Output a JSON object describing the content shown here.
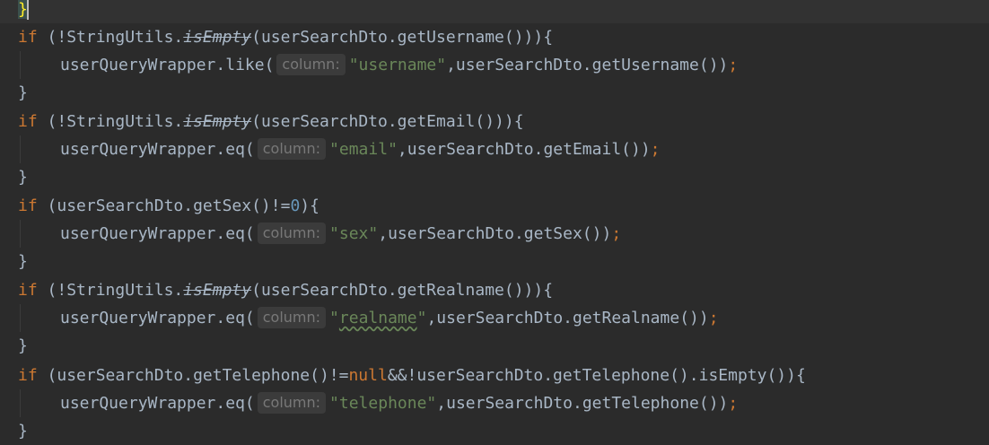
{
  "editor": {
    "lines": [
      {
        "brace": "}"
      },
      {
        "kw": "if",
        "open": " (!StringUtils.",
        "call": "isEmpty",
        "rest": "(userSearchDto.getUsername())){"
      },
      {
        "pre": "userQueryWrapper.like(",
        "hint": "column:",
        "str": "\"username\"",
        "post": ",userSearchDto.getUsername())",
        "semi": ";"
      },
      {
        "brace": "}"
      },
      {
        "kw": "if",
        "open": " (!StringUtils.",
        "call": "isEmpty",
        "rest": "(userSearchDto.getEmail())){"
      },
      {
        "pre": "userQueryWrapper.eq(",
        "hint": "column:",
        "str": "\"email\"",
        "post": ",userSearchDto.getEmail())",
        "semi": ";"
      },
      {
        "brace": "}"
      },
      {
        "kw": "if",
        "open": " (userSearchDto.getSex()!=",
        "num": "0",
        "rest": "){"
      },
      {
        "pre": "userQueryWrapper.eq(",
        "hint": "column:",
        "str": "\"sex\"",
        "post": ",userSearchDto.getSex())",
        "semi": ";"
      },
      {
        "brace": "}"
      },
      {
        "kw": "if",
        "open": " (!StringUtils.",
        "call": "isEmpty",
        "rest": "(userSearchDto.getRealname())){"
      },
      {
        "pre": "userQueryWrapper.eq(",
        "hint": "column:",
        "str_q1": "\"",
        "str_word": "realname",
        "str_q2": "\"",
        "post": ",userSearchDto.getRealname())",
        "semi": ";"
      },
      {
        "brace": "}"
      },
      {
        "kw": "if",
        "open": " (userSearchDto.getTelephone()!=",
        "kw2": "null",
        "rest": "&&!userSearchDto.getTelephone().isEmpty()){"
      },
      {
        "pre": "userQueryWrapper.eq(",
        "hint": "column:",
        "str": "\"telephone\"",
        "post": ",userSearchDto.getTelephone())",
        "semi": ";"
      },
      {
        "brace": "}"
      }
    ]
  }
}
